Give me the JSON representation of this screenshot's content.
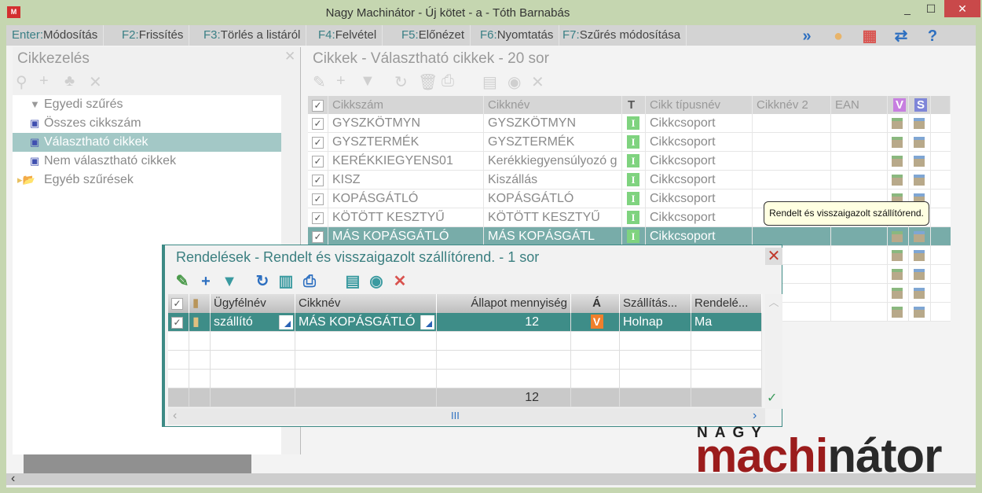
{
  "window": {
    "title": "Nagy Machinátor - Új kötet - a - Tóth Barnabás",
    "minimize": "_",
    "maximize": "☐",
    "close": "✕"
  },
  "toolbar": {
    "keys": [
      {
        "key": "Enter:",
        "label": "Módosítás"
      },
      {
        "key": "F2:",
        "label": "Frissítés"
      },
      {
        "key": "F3:",
        "label": "Törlés a listáról"
      },
      {
        "key": "F4:",
        "label": "Felvétel"
      },
      {
        "key": "F5:",
        "label": "Előnézet"
      },
      {
        "key": "F6:",
        "label": "Nyomtatás"
      },
      {
        "key": "F7:",
        "label": "Szűrés módosítása"
      }
    ],
    "icons": [
      {
        "name": "double-chevron-icon",
        "glyph": "»",
        "color": "#2d6fc0"
      },
      {
        "name": "user-icon",
        "glyph": "●",
        "color": "#e8b46a"
      },
      {
        "name": "tiles-icon",
        "glyph": "▦",
        "color": "#d9534f"
      },
      {
        "name": "swap-icon",
        "glyph": "⇄",
        "color": "#2d6fc0"
      },
      {
        "name": "help-icon",
        "glyph": "?",
        "color": "#2d6fc0"
      }
    ]
  },
  "left_panel": {
    "title": "Cikkezelés",
    "close": "✕",
    "tree": [
      {
        "label": "Egyedi szűrés",
        "icon": "filter-icon",
        "selected": false
      },
      {
        "label": "Összes cikkszám",
        "icon": "computer-icon",
        "selected": false
      },
      {
        "label": "Választható cikkek",
        "icon": "computer-icon",
        "selected": true
      },
      {
        "label": "Nem választható cikkek",
        "icon": "computer-icon",
        "selected": false
      },
      {
        "label": "Egyéb szűrések",
        "icon": "folder-icon",
        "selected": false
      }
    ]
  },
  "right_panel": {
    "title": "Cikkek - Választható cikkek - 20 sor",
    "columns": [
      "Cikkszám",
      "Cikknév",
      "T",
      "Cikk típusnév",
      "Cikknév 2",
      "EAN",
      "V",
      "S"
    ],
    "rows": [
      {
        "code": "GYSZKÖTMYN",
        "name": "GYSZKÖTMYN",
        "t": "I",
        "type": "Cikkcsoport"
      },
      {
        "code": "GYSZTERMÉK",
        "name": "GYSZTERMÉK",
        "t": "I",
        "type": "Cikkcsoport"
      },
      {
        "code": "KERÉKKIEGYENS01",
        "name": "Kerékkiegyensúlyozó g",
        "t": "I",
        "type": "Cikkcsoport"
      },
      {
        "code": "KISZ",
        "name": "Kiszállás",
        "t": "I",
        "type": "Cikkcsoport"
      },
      {
        "code": "KOPÁSGÁTLÓ",
        "name": "KOPÁSGÁTLÓ",
        "t": "I",
        "type": "Cikkcsoport"
      },
      {
        "code": "KÖTÖTT KESZTYŰ",
        "name": "KÖTÖTT KESZTYŰ",
        "t": "I",
        "type": "Cikkcsoport"
      },
      {
        "code": "MÁS KOPÁSGÁTLÓ",
        "name": "MÁS KOPÁSGÁTL",
        "t": "I",
        "type": "Cikkcsoport",
        "selected": true
      }
    ],
    "tooltip": "Rendelt és visszaigazolt szállítórend."
  },
  "dialog": {
    "title": "Rendelések - Rendelt és visszaigazolt szállítórend. - 1 sor",
    "close": "✕",
    "columns": [
      "Ügyfélnév",
      "Cikknév",
      "Állapot mennyiség",
      "Á",
      "Szállítás...",
      "Rendelé..."
    ],
    "rows": [
      {
        "customer": "szállító",
        "item": "MÁS KOPÁSGÁTLÓ",
        "qty": "12",
        "state": "V",
        "delivery": "Holnap",
        "order": "Ma"
      }
    ],
    "footer_total": "12",
    "hscroll_thumb": "III"
  },
  "logo": {
    "top": "NAGY",
    "red": "machi",
    "dark": "nátor"
  }
}
